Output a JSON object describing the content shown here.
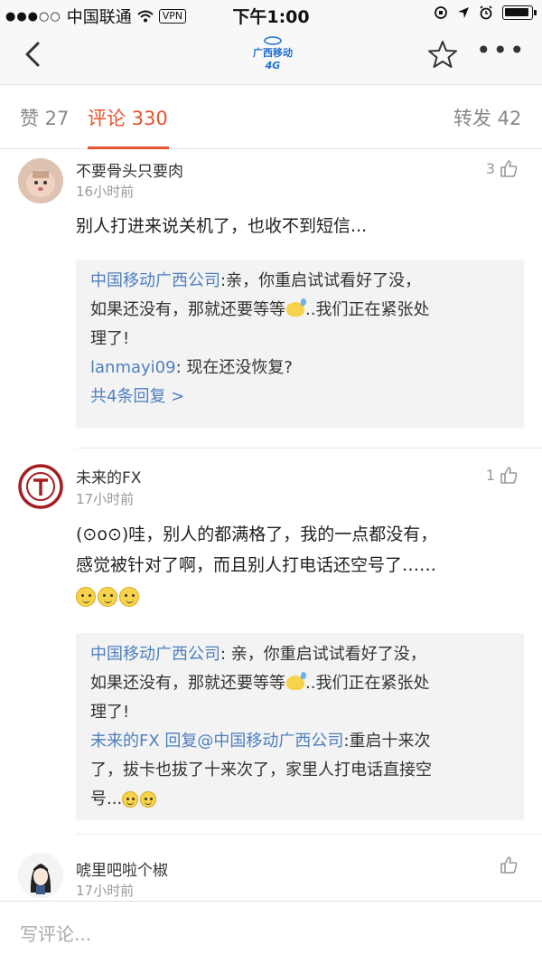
{
  "status_bar": {
    "signal_dots": "●●●○○",
    "carrier": "中国联通",
    "vpn": "VPN",
    "time": "下午1:00"
  },
  "nav": {
    "logo_line1": "广西移动",
    "logo_line2": "4G"
  },
  "tabs": [
    {
      "label": "赞 27"
    },
    {
      "label": "评论 330"
    },
    {
      "label": "转发 42"
    }
  ],
  "comments": [
    {
      "user": "不要骨头只要肉",
      "time": "16小时前",
      "likes": "3",
      "text": "别人打进来说关机了，也收不到短信...",
      "replies": {
        "r1_name": "中国移动广西公司",
        "r1_text_a": ":亲，你重启试试看好了没，",
        "r1_text_b": "如果还没有，那就还要等等",
        "r1_text_c": "..我们正在紧张处",
        "r1_text_d": "理了!",
        "r2_name": "lanmayi09",
        "r2_text": ": 现在还没恢复?",
        "more": "共4条回复 >"
      }
    },
    {
      "user": "未来的FX",
      "time": "17小时前",
      "likes": "1",
      "text_line1": "(⊙o⊙)哇，别人的都满格了，我的一点都没有，",
      "text_line2": "感觉被针对了啊，而且别人打电话还空号了……",
      "replies": {
        "r1_name": "中国移动广西公司",
        "r1_text_a": ": 亲，你重启试试看好了没，",
        "r1_text_b": "如果还没有，那就还要等等",
        "r1_text_c": "..我们正在紧张处",
        "r1_text_d": "理了!",
        "r2_name": "未来的FX 回复@中国移动广西公司",
        "r2_text_a": ":重启十来次",
        "r2_text_b": "了，拔卡也拔了十来次了，家里人打电话直接空",
        "r2_text_c": "号..."
      }
    },
    {
      "user": "唬里吧啦个椒",
      "time": "17小时前"
    }
  ],
  "bottom": {
    "placeholder": "写评论..."
  },
  "colors": {
    "accent": "#e8542f",
    "link_blue": "#4e7fbf"
  }
}
